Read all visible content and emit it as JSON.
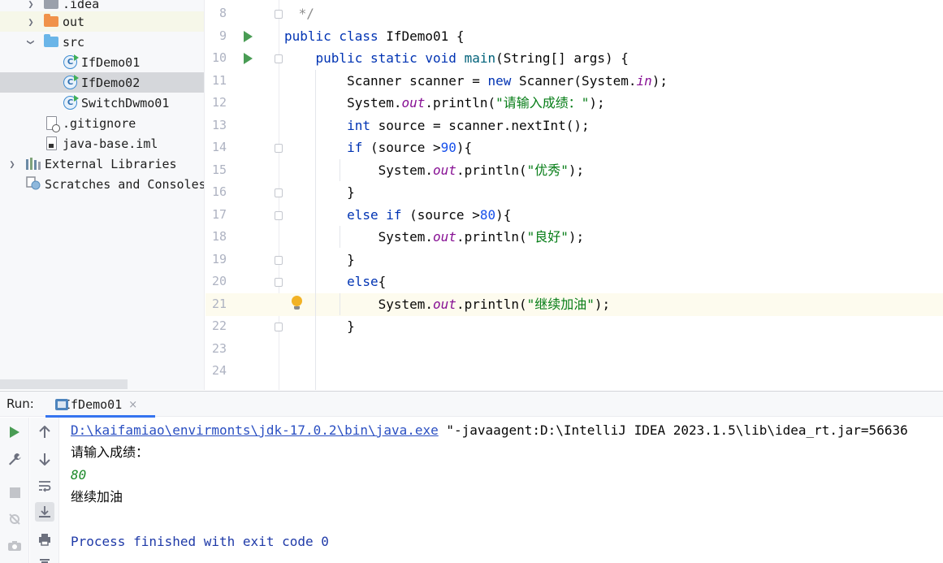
{
  "project_tree": {
    "items": [
      {
        "label": ".idea",
        "indent": 1,
        "icon": "folder-icon",
        "expanded": false
      },
      {
        "label": "out",
        "indent": 1,
        "icon": "folder-orange-icon",
        "expanded": false
      },
      {
        "label": "src",
        "indent": 1,
        "icon": "folder-blue-icon",
        "expanded": true
      },
      {
        "label": "IfDemo01",
        "indent": 2,
        "icon": "java-class-icon"
      },
      {
        "label": "IfDemo02",
        "indent": 2,
        "icon": "java-class-icon",
        "selected": true
      },
      {
        "label": "SwitchDwmo01",
        "indent": 2,
        "icon": "java-class-icon"
      },
      {
        "label": ".gitignore",
        "indent": 1,
        "icon": "ignored-file-icon"
      },
      {
        "label": "java-base.iml",
        "indent": 1,
        "icon": "module-file-icon"
      },
      {
        "label": "External Libraries",
        "indent": 0,
        "icon": "libraries-icon",
        "expanded": false
      },
      {
        "label": "Scratches and Consoles",
        "indent": 0,
        "icon": "scratches-icon"
      }
    ]
  },
  "editor": {
    "lines": [
      {
        "n": "8",
        "text": " */"
      },
      {
        "n": "9",
        "text": "public class IfDemo01 {"
      },
      {
        "n": "10",
        "text": "    public static void main(String[] args) {"
      },
      {
        "n": "11",
        "text": "        Scanner scanner = new Scanner(System.in);"
      },
      {
        "n": "12",
        "text": "        System.out.println(\"请输入成绩：\");"
      },
      {
        "n": "13",
        "text": "        int source = scanner.nextInt();"
      },
      {
        "n": "14",
        "text": "        if (source >90){"
      },
      {
        "n": "15",
        "text": "            System.out.println(\"优秀\");"
      },
      {
        "n": "16",
        "text": "        }"
      },
      {
        "n": "17",
        "text": "        else if (source >80){"
      },
      {
        "n": "18",
        "text": "            System.out.println(\"良好\");"
      },
      {
        "n": "19",
        "text": "        }"
      },
      {
        "n": "20",
        "text": "        else{"
      },
      {
        "n": "21",
        "text": "            System.out.println(\"继续加油\");"
      },
      {
        "n": "22",
        "text": "        }"
      },
      {
        "n": "23",
        "text": ""
      },
      {
        "n": "24",
        "text": ""
      }
    ],
    "current_line": "21"
  },
  "run_panel": {
    "title": "Run:",
    "tab_label": "IfDemo01",
    "tab_close": "×",
    "console": {
      "command_link": "D:\\kaifamiao\\envirmonts\\jdk-17.0.2\\bin\\java.exe",
      "command_rest": " \"-javaagent:D:\\IntelliJ IDEA 2023.1.5\\lib\\idea_rt.jar=56636",
      "prompt": "请输入成绩：",
      "user_input": "80",
      "output": "继续加油",
      "exit_message": "Process finished with exit code 0"
    }
  },
  "colors": {
    "keyword": "#0033b3",
    "string": "#067d17",
    "field": "#871094",
    "number": "#1750eb",
    "run_green": "#499c54",
    "selection": "#d5d7db",
    "current_line": "#fdfbee"
  }
}
